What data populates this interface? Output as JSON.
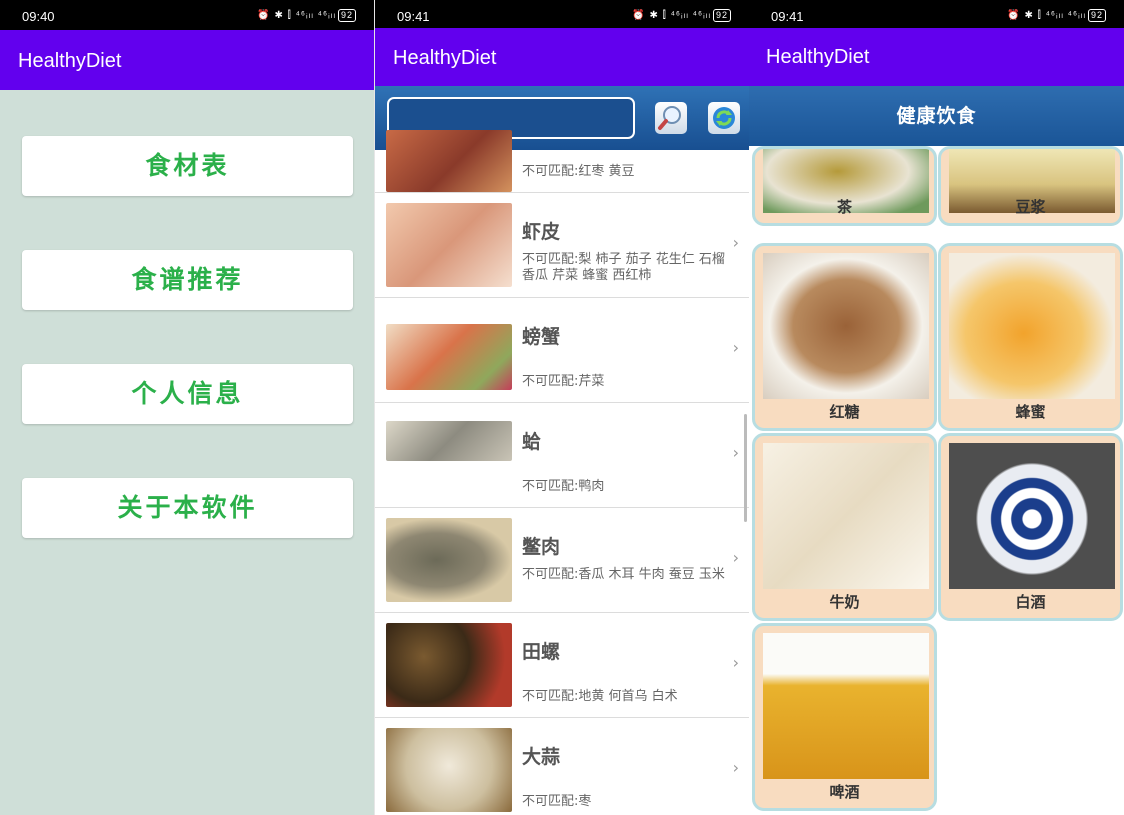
{
  "screens": [
    {
      "status": {
        "time": "09:40",
        "icons": "⏰ ✱ ⫿ ⁴⁶ᵢₗₗ ⁴⁶ᵢₗₗ",
        "battery": "92"
      },
      "title": "HealthyDiet",
      "menu": [
        "食材表",
        "食谱推荐",
        "个人信息",
        "关于本软件"
      ]
    },
    {
      "status": {
        "time": "09:41",
        "icons": "⏰ ✱ ⫿ ⁴⁶ᵢₗₗ ⁴⁶ᵢₗₗ",
        "battery": "92"
      },
      "title": "HealthyDiet",
      "search": {
        "value": "",
        "placeholder": ""
      },
      "items": [
        {
          "title": "",
          "sub": "不可匹配:红枣 黄豆",
          "thumb": "#b5553c"
        },
        {
          "title": "虾皮",
          "sub": "不可匹配:梨 柿子 茄子 花生仁 石榴 香瓜 芹菜 蜂蜜 西红柿",
          "thumb": "#e9b295"
        },
        {
          "title": "螃蟹",
          "sub": "不可匹配:芹菜",
          "thumb": "#d9845c"
        },
        {
          "title": "蛤",
          "sub": "不可匹配:鸭肉",
          "thumb": "#a8a395"
        },
        {
          "title": "鳖肉",
          "sub": "不可匹配:香瓜 木耳 牛肉 蚕豆 玉米",
          "thumb": "#7f7866"
        },
        {
          "title": "田螺",
          "sub": "不可匹配:地黄 何首乌 白术",
          "thumb": "#4c3a22"
        },
        {
          "title": "大蒜",
          "sub": "不可匹配:枣",
          "thumb": "#d8cbb0"
        }
      ]
    },
    {
      "status": {
        "time": "09:41",
        "icons": "⏰ ✱ ⫿ ⁴⁶ᵢₗₗ ⁴⁶ᵢₗₗ",
        "battery": "92"
      },
      "title": "HealthyDiet",
      "header": "健康饮食",
      "tiles": [
        {
          "label": "茶",
          "color": "#c8cfc8"
        },
        {
          "label": "豆浆",
          "color": "#e8d4a0"
        },
        {
          "label": "红糖",
          "color": "#a8734a"
        },
        {
          "label": "蜂蜜",
          "color": "#f0b54a"
        },
        {
          "label": "牛奶",
          "color": "#f1ecdf"
        },
        {
          "label": "白酒",
          "color": "#3c4e7d"
        },
        {
          "label": "啤酒",
          "color": "#e6b230"
        }
      ]
    }
  ]
}
